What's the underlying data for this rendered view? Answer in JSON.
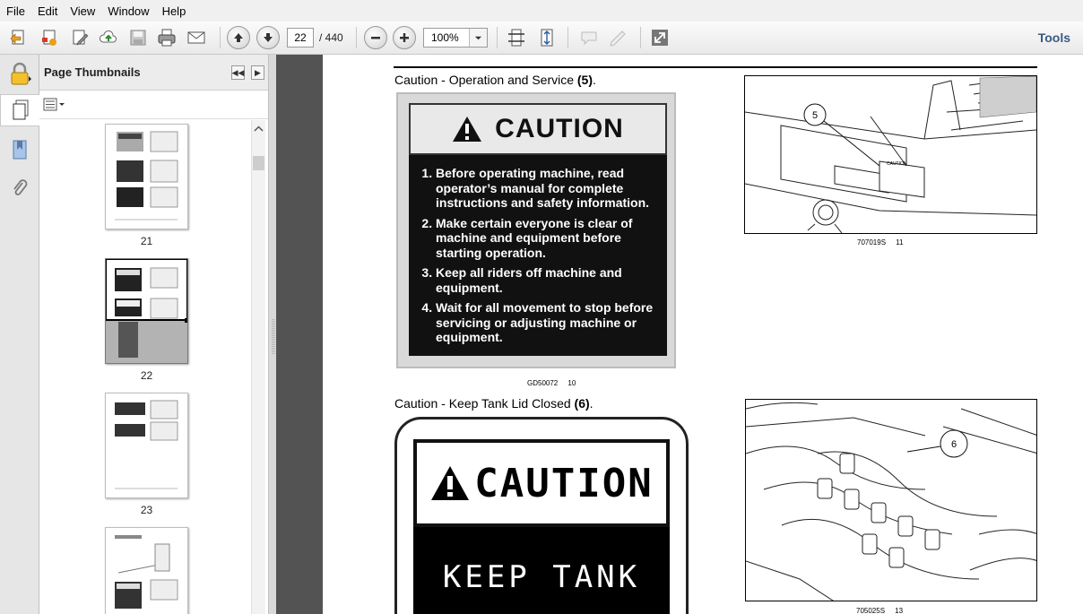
{
  "menu": [
    "File",
    "Edit",
    "View",
    "Window",
    "Help"
  ],
  "toolbar": {
    "current_page": "22",
    "page_total": "/ 440",
    "zoom": "100%",
    "tools_label": "Tools"
  },
  "panel": {
    "title": "Page Thumbnails",
    "thumbnails": [
      {
        "page": "21"
      },
      {
        "page": "22",
        "selected": true
      },
      {
        "page": "23"
      }
    ]
  },
  "doc": {
    "section1_caption_prefix": "Caution - Operation and Service ",
    "section1_caption_ref": "(5)",
    "section1_caption_suffix": ".",
    "caution_heading": "CAUTION",
    "caution_items": [
      "Before operating machine, read operator’s manual for complete instructions and safety information.",
      "Make certain everyone is clear of machine and equipment before starting operation.",
      "Keep all riders off machine and equipment.",
      "Wait for all movement to stop before servicing or adjusting machine or equipment."
    ],
    "fig10_code": "GD50072",
    "fig10_num": "10",
    "fig11_code": "707019S",
    "fig11_num": "11",
    "fig11_callout": "5",
    "fig11_decal": "CAUTION",
    "section2_caption_prefix": "Caution - Keep Tank Lid Closed ",
    "section2_caption_ref": "(6)",
    "section2_caption_suffix": ".",
    "caution2_heading": "CAUTION",
    "caution2_body": "KEEP TANK",
    "fig13_code": "705025S",
    "fig13_num": "13",
    "fig13_callout": "6"
  }
}
